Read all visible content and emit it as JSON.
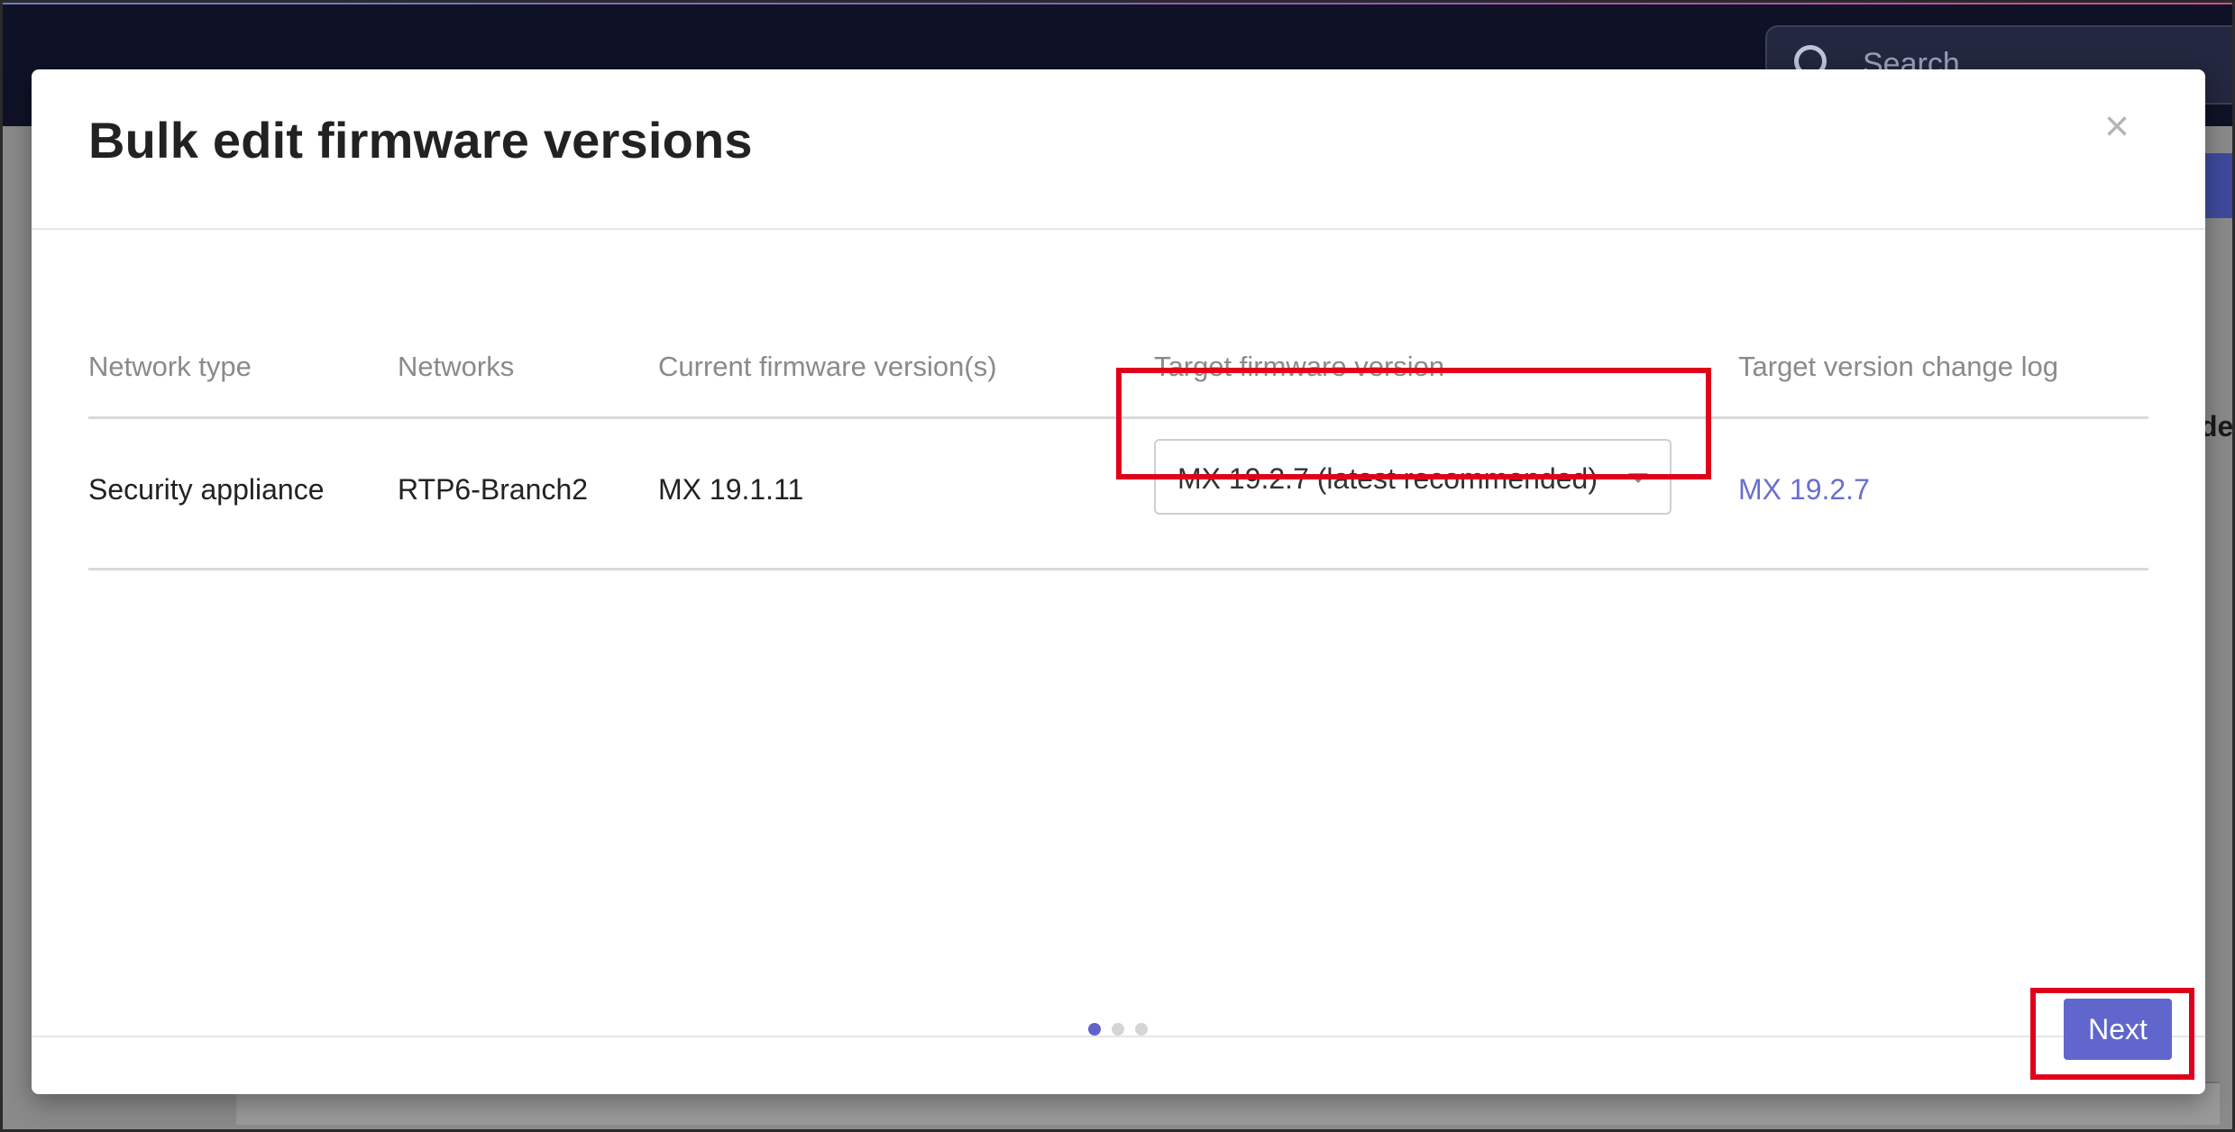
{
  "background": {
    "search_placeholder": "Search",
    "right_text": "de"
  },
  "modal": {
    "title": "Bulk edit firmware versions",
    "close_glyph": "×",
    "table": {
      "headers": [
        "Network type",
        "Networks",
        "Current firmware version(s)",
        "Target firmware version",
        "Target version change log"
      ],
      "rows": [
        {
          "network_type": "Security appliance",
          "networks": "RTP6-Branch2",
          "current_version": "MX 19.1.11",
          "target_version": "MX 19.2.7 (latest recommended)",
          "change_log": "MX 19.2.7"
        }
      ]
    },
    "pagination": {
      "total_steps": 3,
      "active_step": 1
    },
    "next_label": "Next"
  },
  "colors": {
    "accent": "#6066cc",
    "link": "#6a6fd0",
    "highlight": "#e0001b"
  }
}
